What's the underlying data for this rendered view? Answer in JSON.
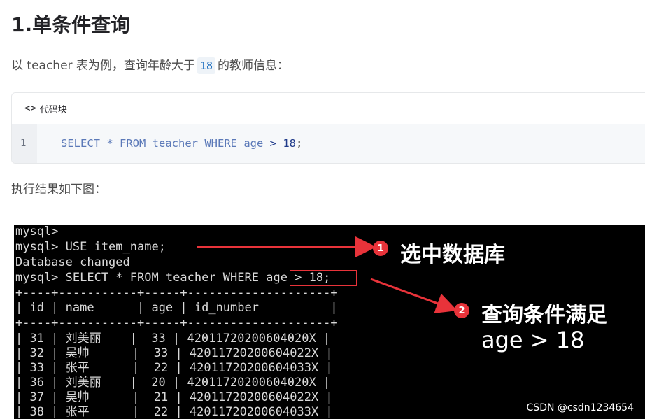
{
  "heading": "1.单条件查询",
  "intro": {
    "before": "以 teacher 表为例，查询年龄大于",
    "code": "18",
    "after": "的教师信息："
  },
  "code_block": {
    "header_label": "代码块",
    "line_number": "1",
    "tokens": {
      "kw_select": "SELECT",
      "star": " * ",
      "kw_from": "FROM",
      "table": " teacher ",
      "kw_where": "WHERE",
      "col": " age ",
      "op": ">",
      "num": " 18",
      "semi": ";"
    }
  },
  "result_text": "执行结果如下图：",
  "terminal": {
    "lines": [
      "mysql>",
      "mysql> USE item_name;",
      "Database changed",
      "mysql> SELECT * FROM teacher WHERE age > 18;",
      "+----+-----------+-----+--------------------+",
      "| id | name      | age | id_number          |",
      "+----+-----------+-----+--------------------+",
      "| 31 | 刘美丽    |  33 | 42011720200604020X |",
      "| 32 | 吴帅      |  33 | 42011720200604022X |",
      "| 33 | 张平      |  22 | 42011720200604033X |",
      "| 36 | 刘美丽    |  20 | 42011720200604020X |",
      "| 37 | 吴帅      |  21 | 42011720200604022X |",
      "| 38 | 张平      |  22 | 42011720200604033X |"
    ],
    "annotation1": {
      "badge": "1",
      "text": "选中数据库"
    },
    "annotation2": {
      "badge": "2",
      "text_line1": "查询条件满足",
      "text_line2": "age > 18"
    },
    "watermark": "CSDN @csdn1234654"
  },
  "colors": {
    "accent_red": "#e8333a",
    "terminal_bg": "#000000",
    "inline_code": "#1f6fbf"
  }
}
